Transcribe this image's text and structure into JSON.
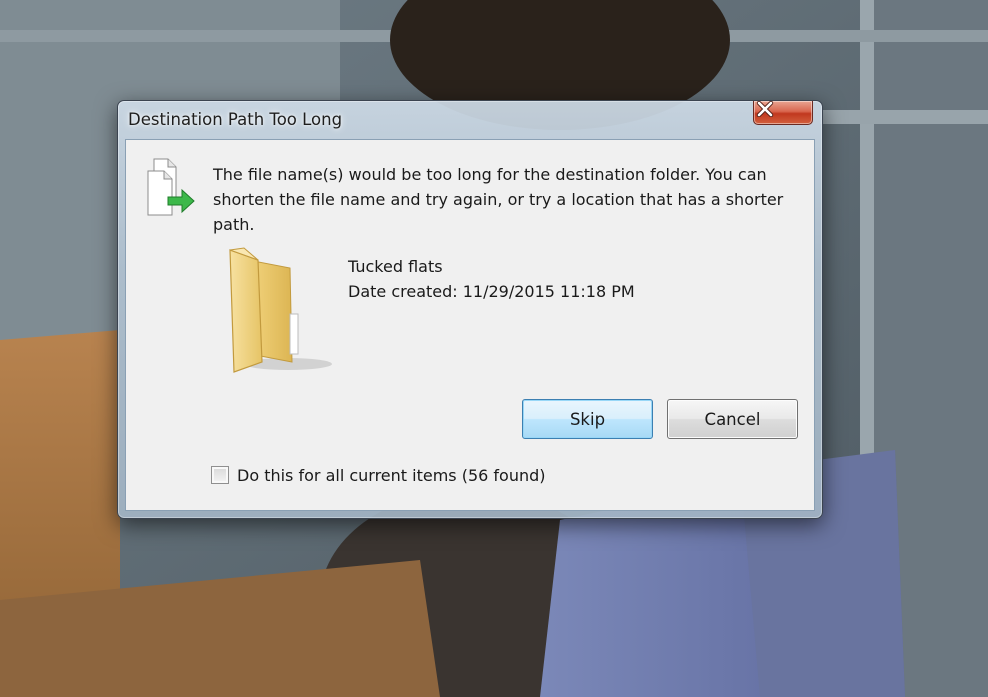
{
  "dialog": {
    "title": "Destination Path Too Long",
    "close_icon": "close-icon",
    "message": "The file name(s) would be too long for the destination folder.  You can shorten the file name and try again, or try a location that has a shorter path.",
    "header_icon": "file-move-icon",
    "item": {
      "icon": "folder-icon",
      "name": "Tucked flats",
      "date_created": "Date created: 11/29/2015 11:18 PM"
    },
    "buttons": {
      "skip_label": "Skip",
      "cancel_label": "Cancel"
    },
    "checkbox": {
      "checked": false,
      "label": "Do this for all current items (56 found)"
    }
  },
  "colors": {
    "client_background": "#f0f0f0",
    "close_button": "#c9432a",
    "default_button_border": "#3c7fb1",
    "folder": "#f3d57f"
  }
}
